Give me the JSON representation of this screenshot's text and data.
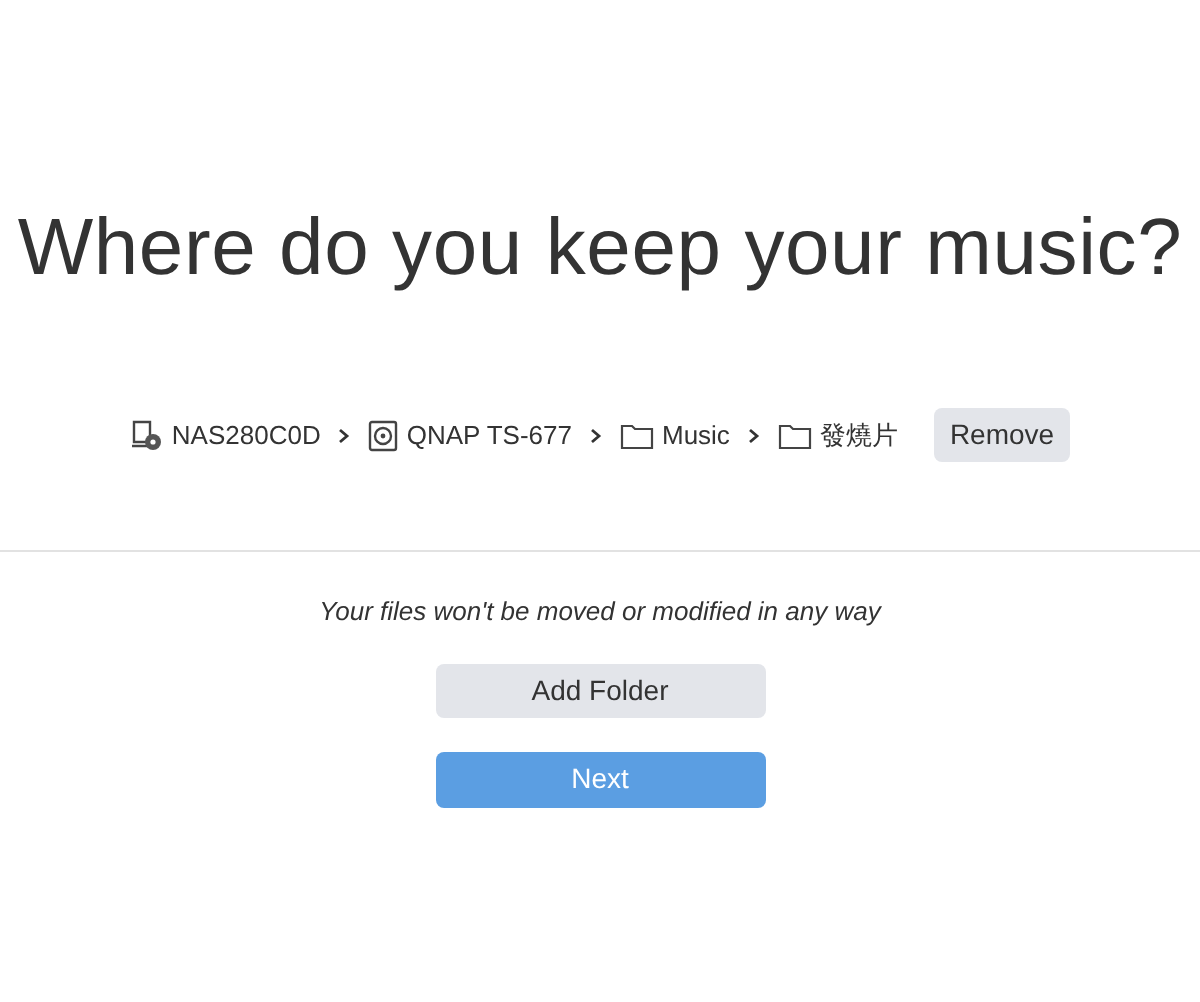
{
  "title": "Where do you keep your music?",
  "path": [
    {
      "kind": "server",
      "label": "NAS280C0D"
    },
    {
      "kind": "disk",
      "label": "QNAP TS-677"
    },
    {
      "kind": "folder",
      "label": "Music"
    },
    {
      "kind": "folder",
      "label": "發燒片"
    }
  ],
  "remove_button": "Remove",
  "note": "Your files won't be moved or modified in any way",
  "add_button": "Add Folder",
  "next_button": "Next"
}
